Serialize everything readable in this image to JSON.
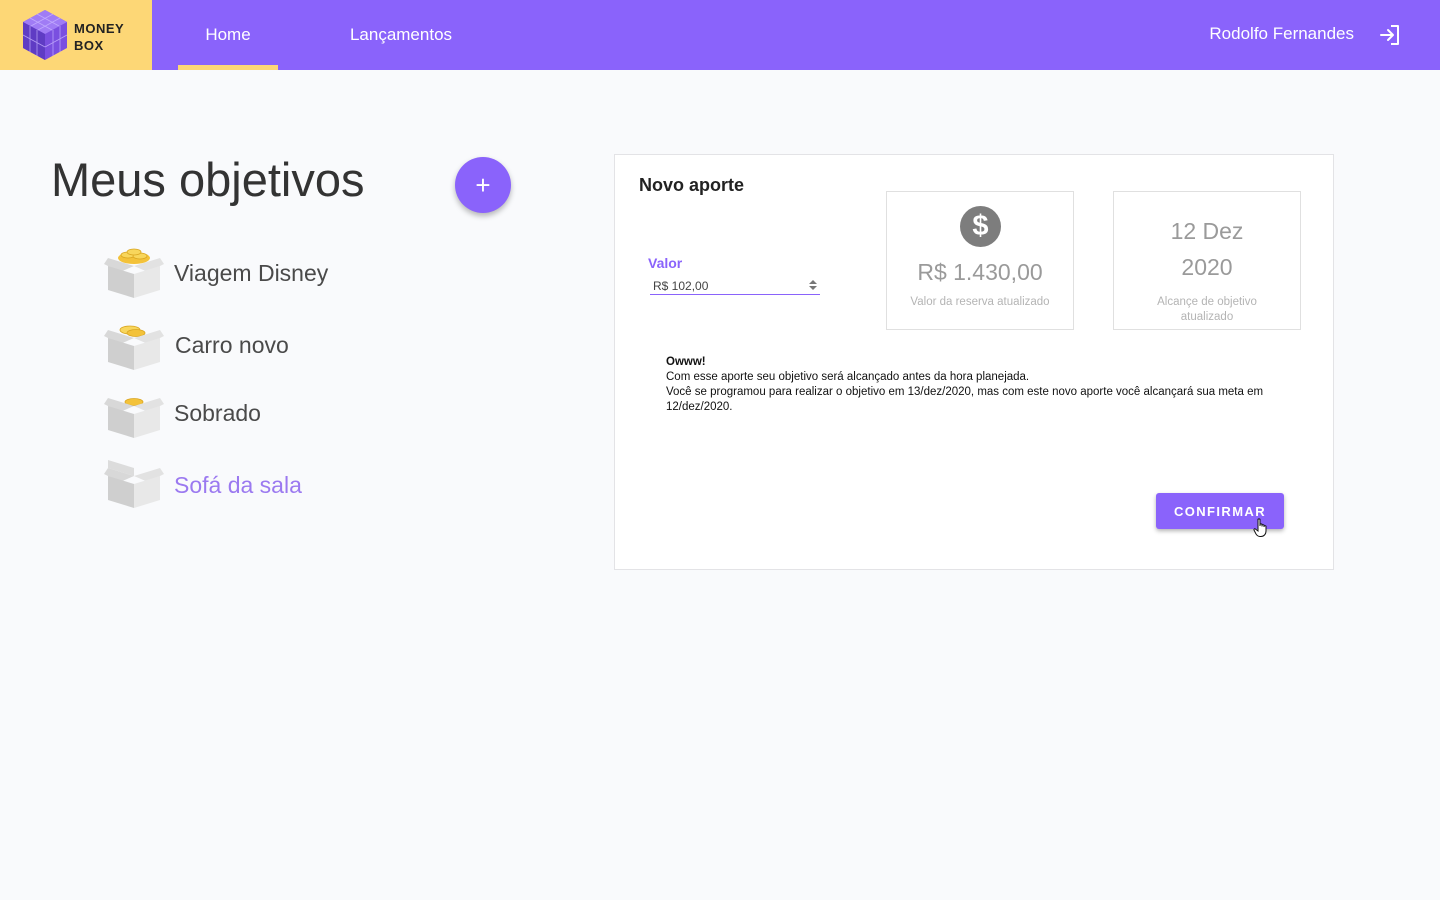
{
  "header": {
    "logo_line1": "MONEY",
    "logo_line2": "BOX",
    "nav": [
      {
        "label": "Home",
        "active": true
      },
      {
        "label": "Lançamentos",
        "active": false
      }
    ],
    "user_name": "Rodolfo Fernandes",
    "logout_icon": "logout-icon"
  },
  "goals": {
    "title": "Meus objetivos",
    "add_label": "+",
    "items": [
      {
        "label": "Viagem Disney",
        "icon": "box-with-coins-icon"
      },
      {
        "label": "Carro novo",
        "icon": "box-with-coins-icon"
      },
      {
        "label": "Sobrado",
        "icon": "box-with-coins-icon"
      },
      {
        "label": "Sofá da sala",
        "icon": "empty-box-icon",
        "active": true
      }
    ]
  },
  "card": {
    "title": "Novo aporte",
    "field_label": "Valor",
    "field_value": "R$ 102,00",
    "reserve": {
      "icon_glyph": "$",
      "value": "R$ 1.430,00",
      "caption": "Valor da reserva atualizado"
    },
    "goal_date": {
      "line1": "12 Dez",
      "line2": "2020",
      "caption": "Alcançe de objetivo atualizado"
    },
    "message": {
      "title": "Owww!",
      "line1": "Com esse aporte seu objetivo será alcançado antes da hora planejada.",
      "line2": "Você se programou para realizar o objetivo em 13/dez/2020, mas com este novo aporte você alcançará sua meta em 12/dez/2020."
    },
    "confirm_label": "CONFIRMAR"
  },
  "colors": {
    "primary": "#8a63fb",
    "accent": "#fdd776",
    "background": "#f9fafc"
  }
}
